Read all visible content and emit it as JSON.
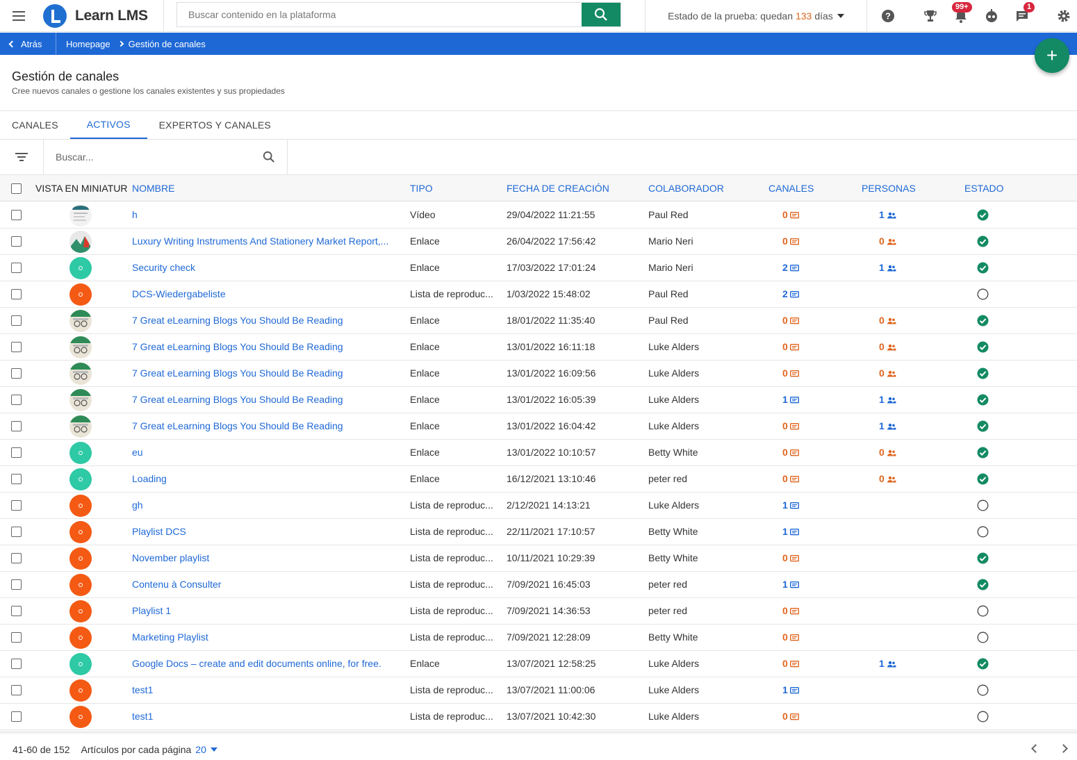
{
  "app": {
    "name": "Learn LMS",
    "search_placeholder": "Buscar contenido en la plataforma",
    "trial_label": "Estado de la prueba: quedan",
    "trial_days": "133",
    "trial_suffix": "días",
    "notifications_badge": "99+",
    "messages_badge": "1"
  },
  "breadcrumb": {
    "back": "Atrás",
    "home": "Homepage",
    "current": "Gestión de canales"
  },
  "fab_label": "+",
  "page": {
    "title": "Gestión de canales",
    "subtitle": "Cree nuevos canales o gestione los canales existentes y sus propiedades"
  },
  "tabs": [
    {
      "label": "CANALES",
      "active": false
    },
    {
      "label": "ACTIVOS",
      "active": true
    },
    {
      "label": "EXPERTOS Y CANALES",
      "active": false
    }
  ],
  "grid_search_placeholder": "Buscar...",
  "columns": {
    "thumb": "VISTA EN MINIATURA",
    "name": "NOMBRE",
    "type": "TIPO",
    "date": "FECHA DE CREACIÓN",
    "collab": "COLABORADOR",
    "channels": "CANALES",
    "people": "PERSONAS",
    "state": "ESTADO"
  },
  "rows": [
    {
      "thumb": "video",
      "name": "h",
      "type": "Vídeo",
      "date": "29/04/2022 11:21:55",
      "collab": "Paul Red",
      "channels": "0",
      "people": "1",
      "active": true
    },
    {
      "thumb": "report",
      "name": "Luxury Writing Instruments And Stationery Market Report,...",
      "type": "Enlace",
      "date": "26/04/2022 17:56:42",
      "collab": "Mario Neri",
      "channels": "0",
      "people": "0",
      "active": true
    },
    {
      "thumb": "link",
      "name": "Security check",
      "type": "Enlace",
      "date": "17/03/2022 17:01:24",
      "collab": "Mario Neri",
      "channels": "2",
      "people": "1",
      "active": true
    },
    {
      "thumb": "list",
      "name": "DCS-Wiedergabeliste",
      "type": "Lista de reproduc...",
      "date": "1/03/2022 15:48:02",
      "collab": "Paul Red",
      "channels": "2",
      "people": "",
      "active": false
    },
    {
      "thumb": "blog",
      "name": "7 Great eLearning Blogs You Should Be Reading",
      "type": "Enlace",
      "date": "18/01/2022 11:35:40",
      "collab": "Paul Red",
      "channels": "0",
      "people": "0",
      "active": true
    },
    {
      "thumb": "blog",
      "name": "7 Great eLearning Blogs You Should Be Reading",
      "type": "Enlace",
      "date": "13/01/2022 16:11:18",
      "collab": "Luke Alders",
      "channels": "0",
      "people": "0",
      "active": true
    },
    {
      "thumb": "blog",
      "name": "7 Great eLearning Blogs You Should Be Reading",
      "type": "Enlace",
      "date": "13/01/2022 16:09:56",
      "collab": "Luke Alders",
      "channels": "0",
      "people": "0",
      "active": true
    },
    {
      "thumb": "blog",
      "name": "7 Great eLearning Blogs You Should Be Reading",
      "type": "Enlace",
      "date": "13/01/2022 16:05:39",
      "collab": "Luke Alders",
      "channels": "1",
      "people": "1",
      "active": true
    },
    {
      "thumb": "blog",
      "name": "7 Great eLearning Blogs You Should Be Reading",
      "type": "Enlace",
      "date": "13/01/2022 16:04:42",
      "collab": "Luke Alders",
      "channels": "0",
      "people": "1",
      "active": true
    },
    {
      "thumb": "link",
      "name": "eu",
      "type": "Enlace",
      "date": "13/01/2022 10:10:57",
      "collab": "Betty White",
      "channels": "0",
      "people": "0",
      "active": true
    },
    {
      "thumb": "link",
      "name": "Loading",
      "type": "Enlace",
      "date": "16/12/2021 13:10:46",
      "collab": "peter red",
      "channels": "0",
      "people": "0",
      "active": true
    },
    {
      "thumb": "list",
      "name": "gh",
      "type": "Lista de reproduc...",
      "date": "2/12/2021 14:13:21",
      "collab": "Luke Alders",
      "channels": "1",
      "people": "",
      "active": false
    },
    {
      "thumb": "list",
      "name": "Playlist DCS",
      "type": "Lista de reproduc...",
      "date": "22/11/2021 17:10:57",
      "collab": "Betty White",
      "channels": "1",
      "people": "",
      "active": false
    },
    {
      "thumb": "list",
      "name": "November playlist",
      "type": "Lista de reproduc...",
      "date": "10/11/2021 10:29:39",
      "collab": "Betty White",
      "channels": "0",
      "people": "",
      "active": true
    },
    {
      "thumb": "list",
      "name": "Contenu à Consulter",
      "type": "Lista de reproduc...",
      "date": "7/09/2021 16:45:03",
      "collab": "peter red",
      "channels": "1",
      "people": "",
      "active": true
    },
    {
      "thumb": "list",
      "name": "Playlist 1",
      "type": "Lista de reproduc...",
      "date": "7/09/2021 14:36:53",
      "collab": "peter red",
      "channels": "0",
      "people": "",
      "active": false
    },
    {
      "thumb": "list",
      "name": "Marketing Playlist",
      "type": "Lista de reproduc...",
      "date": "7/09/2021 12:28:09",
      "collab": "Betty White",
      "channels": "0",
      "people": "",
      "active": false
    },
    {
      "thumb": "link",
      "name": "Google Docs – create and edit documents online, for free.",
      "type": "Enlace",
      "date": "13/07/2021 12:58:25",
      "collab": "Luke Alders",
      "channels": "0",
      "people": "1",
      "active": true
    },
    {
      "thumb": "list",
      "name": "test1",
      "type": "Lista de reproduc...",
      "date": "13/07/2021 11:00:06",
      "collab": "Luke Alders",
      "channels": "1",
      "people": "",
      "active": false
    },
    {
      "thumb": "list",
      "name": "test1",
      "type": "Lista de reproduc...",
      "date": "13/07/2021 10:42:30",
      "collab": "Luke Alders",
      "channels": "0",
      "people": "",
      "active": false
    }
  ],
  "pagination": {
    "range": "41-60 de 152",
    "per_page_label": "Artículos por cada página",
    "per_page": "20"
  },
  "colors": {
    "primary": "#1e68d6",
    "accent_green": "#138a63",
    "zero_orange": "#e0651e",
    "status_green": "#138a63"
  }
}
